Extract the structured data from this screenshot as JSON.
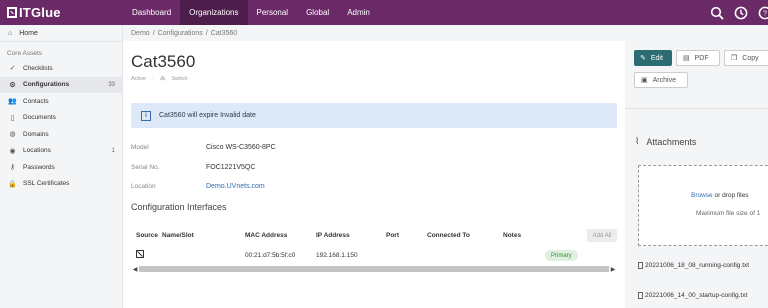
{
  "topnav": {
    "logo": "ITGlue",
    "items": [
      "Dashboard",
      "Organizations",
      "Personal",
      "Global",
      "Admin"
    ],
    "active": "Organizations",
    "bg_color": "#6a2a67",
    "active_color": "#4d1d4b",
    "icons": [
      "search-icon",
      "clock-icon",
      "help-icon"
    ]
  },
  "sidebar": {
    "home": "Home",
    "section": "Core Assets",
    "items": [
      {
        "label": "Checklists",
        "icon": "check-icon",
        "count": ""
      },
      {
        "label": "Configurations",
        "icon": "gear-icon",
        "count": "33"
      },
      {
        "label": "Contacts",
        "icon": "contacts-icon",
        "count": ""
      },
      {
        "label": "Documents",
        "icon": "document-icon",
        "count": ""
      },
      {
        "label": "Domains",
        "icon": "globe-icon",
        "count": ""
      },
      {
        "label": "Locations",
        "icon": "pin-icon",
        "count": "1"
      },
      {
        "label": "Passwords",
        "icon": "key-icon",
        "count": ""
      },
      {
        "label": "SSL Certificates",
        "icon": "lock-icon",
        "count": ""
      }
    ]
  },
  "breadcrumb": [
    "Demo",
    "Configurations",
    "Cat3560"
  ],
  "page": {
    "title": "Cat3560",
    "status": "Active",
    "type": "Switch"
  },
  "alert": {
    "text": "Cat3560 will expire Invalid date"
  },
  "fields": [
    {
      "label": "Model",
      "value": "Cisco WS-C3560-8PC"
    },
    {
      "label": "Serial No.",
      "value": "FOC1221V5QC"
    },
    {
      "label": "Location",
      "value": "Demo.UVnets.com"
    }
  ],
  "interfaces": {
    "heading": "Configuration Interfaces",
    "columns": [
      "Source",
      "Name/Slot",
      "MAC Address",
      "IP Address",
      "Port",
      "Connected To",
      "Notes"
    ],
    "add_all": "Add All",
    "rows": [
      {
        "name": "",
        "mac": "00:21:d7:5b:5f:c0",
        "ip": "192.168.1.150",
        "port": "",
        "connected": "",
        "notes": "",
        "badge": "Primary"
      }
    ]
  },
  "actions": {
    "edit": "Edit",
    "pdf": "PDF",
    "copy": "Copy",
    "archive": "Archive",
    "edit_color": "#2d6b73"
  },
  "attachments": {
    "heading": "Attachments",
    "browse": "Browse",
    "drop_text": "or drop files",
    "max_text": "Maximum file size of 1",
    "files": [
      "20221006_18_08_running-config.txt",
      "20221006_14_00_startup-config.txt"
    ]
  }
}
